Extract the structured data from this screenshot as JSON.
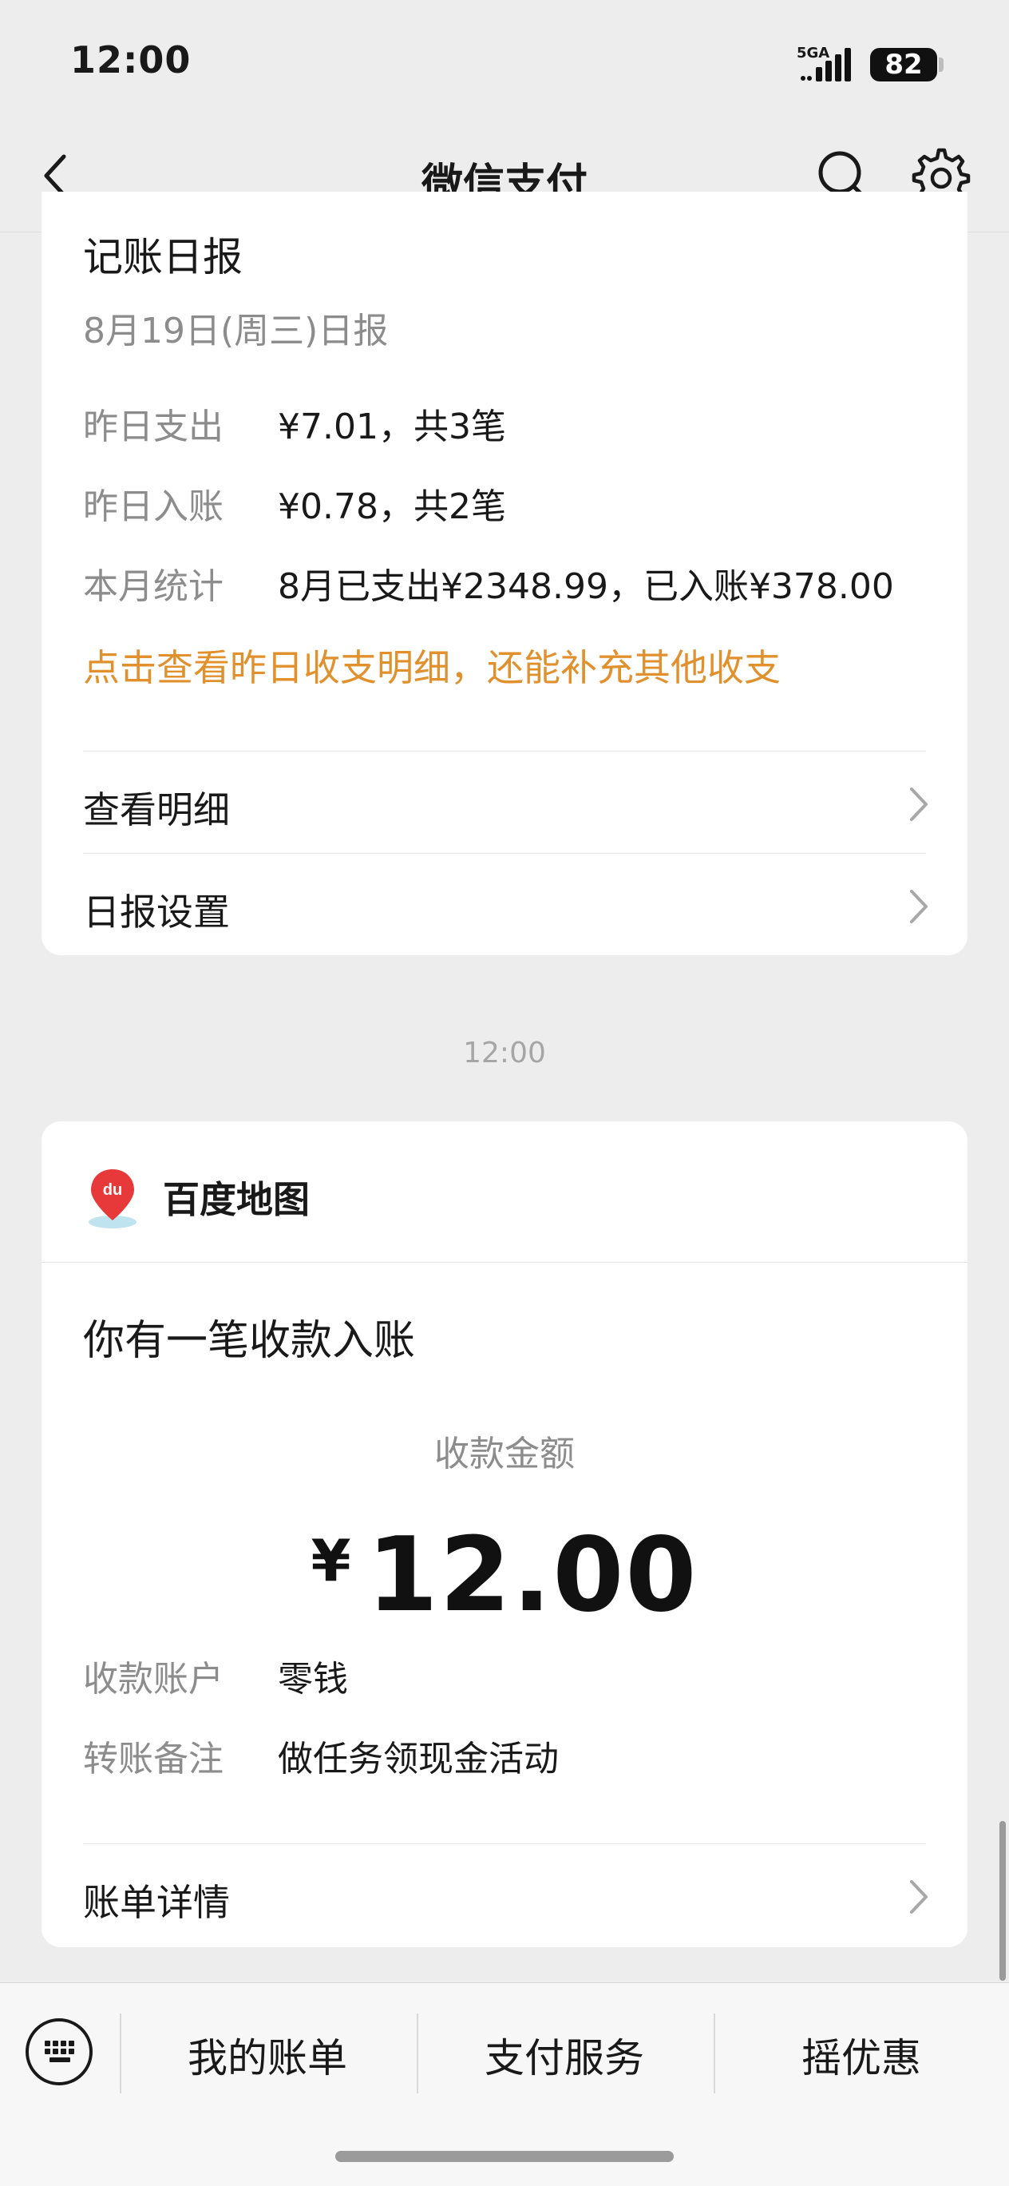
{
  "status_bar": {
    "time": "12:00",
    "network": "5GA",
    "battery": "82"
  },
  "nav": {
    "title": "微信支付",
    "back_icon": "back-arrow-icon",
    "search_icon": "search-icon",
    "settings_icon": "gear-icon"
  },
  "daily_report": {
    "title": "记账日报",
    "subtitle": "8月19日(周三)日报",
    "rows": [
      {
        "label": "昨日支出",
        "value": "¥7.01，共3笔"
      },
      {
        "label": "昨日入账",
        "value": "¥0.78，共2笔"
      },
      {
        "label": "本月统计",
        "value": "8月已支出¥2348.99，已入账¥378.00"
      }
    ],
    "hint": "点击查看昨日收支明细，还能补充其他收支",
    "actions": [
      {
        "label": "查看明细"
      },
      {
        "label": "日报设置"
      }
    ]
  },
  "timestamp": "12:00",
  "payment": {
    "merchant": "百度地图",
    "title": "你有一笔收款入账",
    "amount_label": "收款金额",
    "currency": "¥",
    "amount": "12.00",
    "rows": [
      {
        "label": "收款账户",
        "value": "零钱"
      },
      {
        "label": "转账备注",
        "value": "做任务领现金活动"
      }
    ],
    "action": "账单详情"
  },
  "bottom_menu": {
    "items": [
      "我的账单",
      "支付服务",
      "摇优惠"
    ]
  },
  "colors": {
    "accent_orange": "#e0912e",
    "background": "#ededed"
  }
}
